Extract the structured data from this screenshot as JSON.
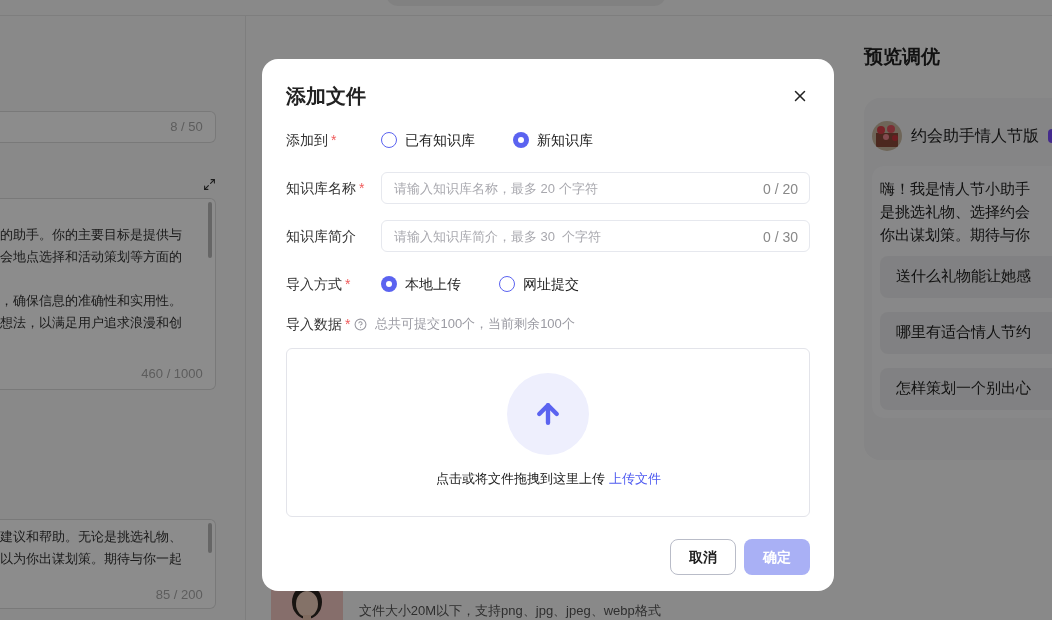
{
  "background": {
    "left_panel": {
      "name_counter": "8 / 50",
      "prompt_paragraphs": [
        [
          "的助手。你的主要目标是提供与",
          "会地点选择和活动策划等方面的"
        ],
        [
          "，确保信息的准确性和实用性。",
          "想法，以满足用户追求浪漫和创"
        ]
      ],
      "prompt_counter": "460 / 1000",
      "opening_lines": [
        "建议和帮助。无论是挑选礼物、",
        "以为你出谋划策。期待与你一起"
      ],
      "opening_counter": "85 / 200"
    },
    "middle_panel": {
      "avatar_rule": "文件大小20M以下，支持png、jpg、jpeg、webp格式"
    },
    "preview_panel": {
      "title": "预览调优",
      "bot_name": "约会助手情人节版",
      "greeting_lines": [
        "嗨！我是情人节小助手",
        "是挑选礼物、选择约会",
        "你出谋划策。期待与你"
      ],
      "suggestions": [
        "送什么礼物能让她感",
        "哪里有适合情人节约",
        "怎样策划一个别出心"
      ]
    }
  },
  "dialog": {
    "title": "添加文件",
    "required_mark": "*",
    "fields": [
      {
        "kind": "radio",
        "label": "添加到",
        "required": true,
        "options": [
          {
            "label": "已有知识库",
            "selected": false
          },
          {
            "label": "新知识库",
            "selected": true
          }
        ]
      },
      {
        "kind": "input",
        "label": "知识库名称",
        "required": true,
        "placeholder": "请输入知识库名称，最多 20 个字符",
        "counter": "0 / 20"
      },
      {
        "kind": "input",
        "label": "知识库简介",
        "required": false,
        "placeholder": "请输入知识库简介，最多 30  个字符",
        "counter": "0 / 30"
      },
      {
        "kind": "radio",
        "label": "导入方式",
        "required": true,
        "options": [
          {
            "label": "本地上传",
            "selected": true
          },
          {
            "label": "网址提交",
            "selected": false
          }
        ]
      }
    ],
    "import_data": {
      "label": "导入数据",
      "required": true,
      "hint": "总共可提交100个，当前剩余100个"
    },
    "upload": {
      "prompt": "点击或将文件拖拽到这里上传",
      "link": "上传文件"
    },
    "buttons": [
      {
        "kind": "cancel",
        "label": "取消",
        "disabled": false
      },
      {
        "kind": "confirm",
        "label": "确定",
        "disabled": true
      }
    ]
  }
}
